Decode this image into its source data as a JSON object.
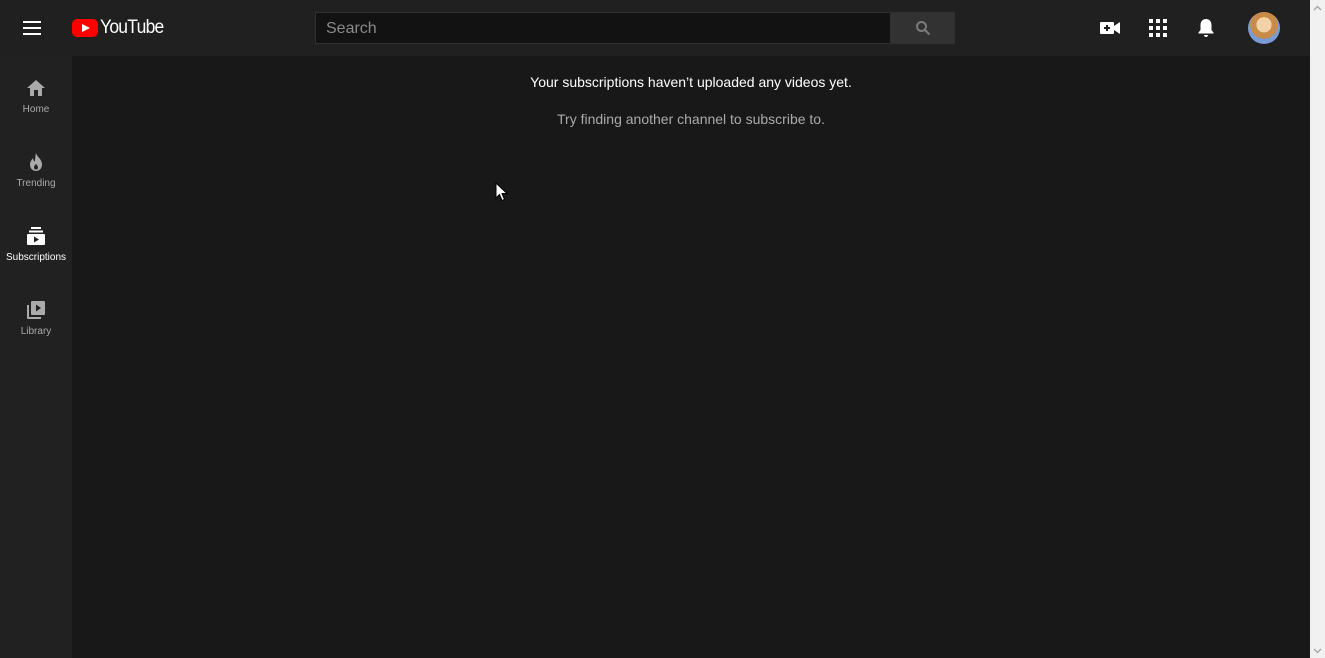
{
  "masthead": {
    "logo_text": "YouTube",
    "search_placeholder": "Search",
    "search_value": ""
  },
  "sidebar": {
    "items": [
      {
        "label": "Home",
        "icon": "home-icon"
      },
      {
        "label": "Trending",
        "icon": "flame-icon"
      },
      {
        "label": "Subscriptions",
        "icon": "subscriptions-icon",
        "active": true
      },
      {
        "label": "Library",
        "icon": "library-icon"
      }
    ]
  },
  "main": {
    "empty_title": "Your subscriptions haven’t uploaded any videos yet.",
    "empty_subtitle": "Try finding another channel to subscribe to."
  },
  "colors": {
    "brand_red": "#ff0000",
    "masthead_bg": "#202020",
    "page_bg": "#181818",
    "sidebar_bg": "#212121"
  }
}
